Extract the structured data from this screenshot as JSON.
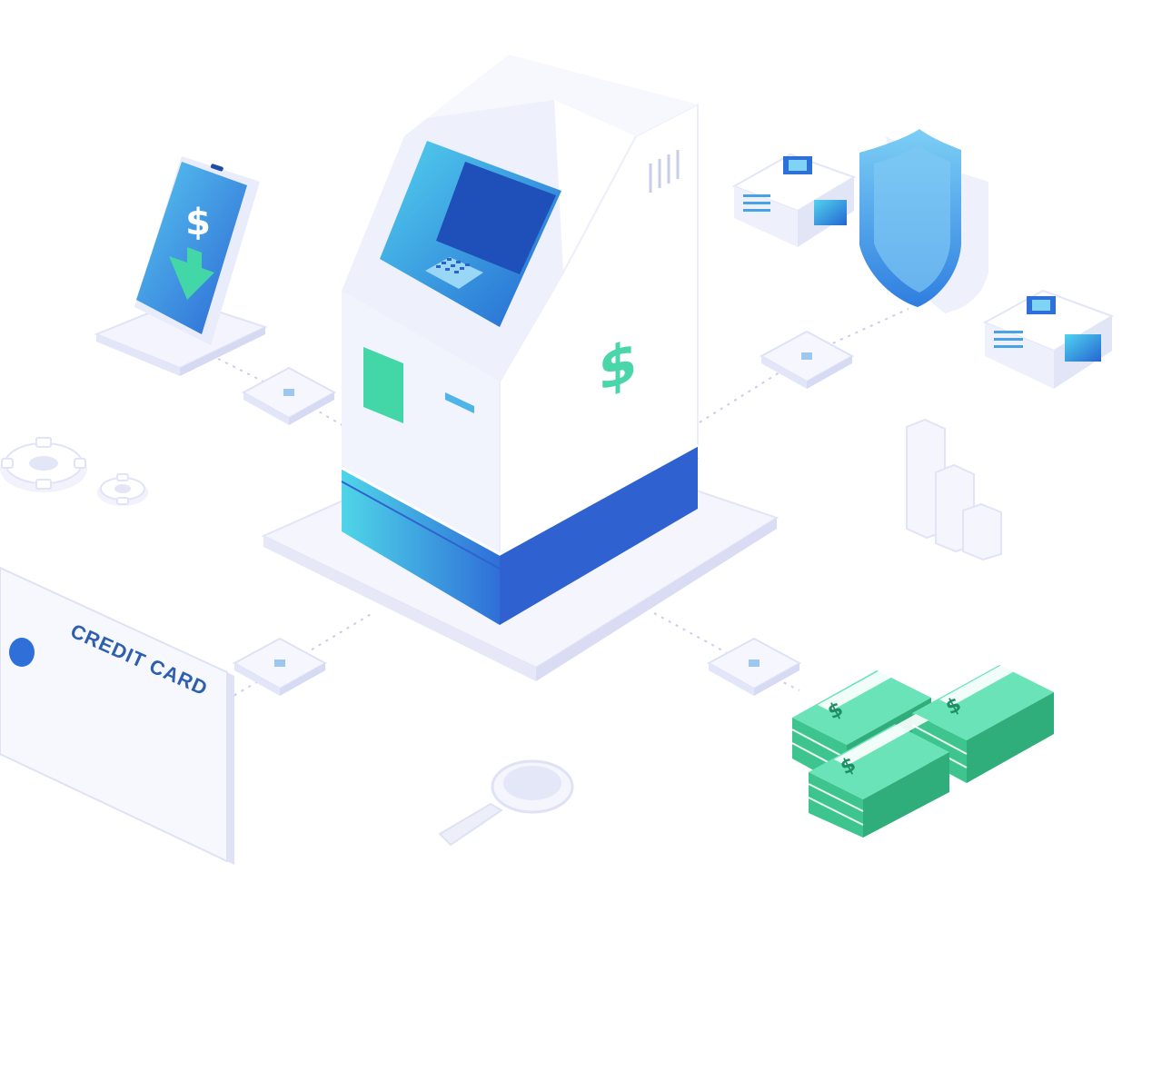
{
  "illustration": {
    "credit_card_text": "CREDIT CARD",
    "currency_symbol": "$",
    "icons": [
      "atm-icon",
      "phone-icon",
      "server-icon",
      "shield-icon",
      "gear-icon",
      "bar-chart-icon",
      "credit-card-icon",
      "magnifier-icon",
      "cash-stack-icon",
      "chip-node-icon"
    ],
    "colors": {
      "primary_blue": "#2f6fd8",
      "cyan": "#4fd6e8",
      "mint_green": "#5fe0b0",
      "cash_green": "#3ec48f",
      "light_surface": "#f2f4fd",
      "shadow_lavender": "#dfe2f7"
    }
  }
}
